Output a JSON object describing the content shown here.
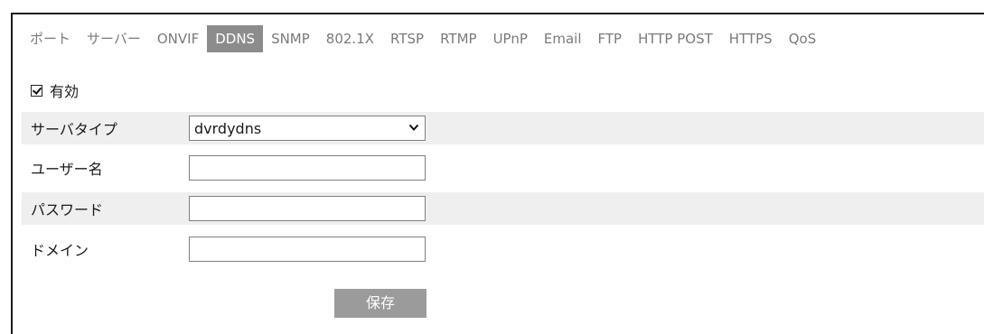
{
  "tabs": [
    {
      "label": "ポート",
      "active": false
    },
    {
      "label": "サーバー",
      "active": false
    },
    {
      "label": "ONVIF",
      "active": false
    },
    {
      "label": "DDNS",
      "active": true
    },
    {
      "label": "SNMP",
      "active": false
    },
    {
      "label": "802.1X",
      "active": false
    },
    {
      "label": "RTSP",
      "active": false
    },
    {
      "label": "RTMP",
      "active": false
    },
    {
      "label": "UPnP",
      "active": false
    },
    {
      "label": "Email",
      "active": false
    },
    {
      "label": "FTP",
      "active": false
    },
    {
      "label": "HTTP POST",
      "active": false
    },
    {
      "label": "HTTPS",
      "active": false
    },
    {
      "label": "QoS",
      "active": false
    }
  ],
  "enable": {
    "label": "有効",
    "checked": true
  },
  "form": {
    "server_type": {
      "label": "サーバタイプ",
      "value": "dvrdydns"
    },
    "username": {
      "label": "ユーザー名",
      "value": ""
    },
    "password": {
      "label": "パスワード",
      "value": ""
    },
    "domain": {
      "label": "ドメイン",
      "value": ""
    }
  },
  "save_label": "保存",
  "colors": {
    "active_tab_bg": "#8c8c8c",
    "inactive_tab_text": "#7a7a7a",
    "row_shade": "#efefef",
    "button_bg": "#9b9b9b"
  }
}
